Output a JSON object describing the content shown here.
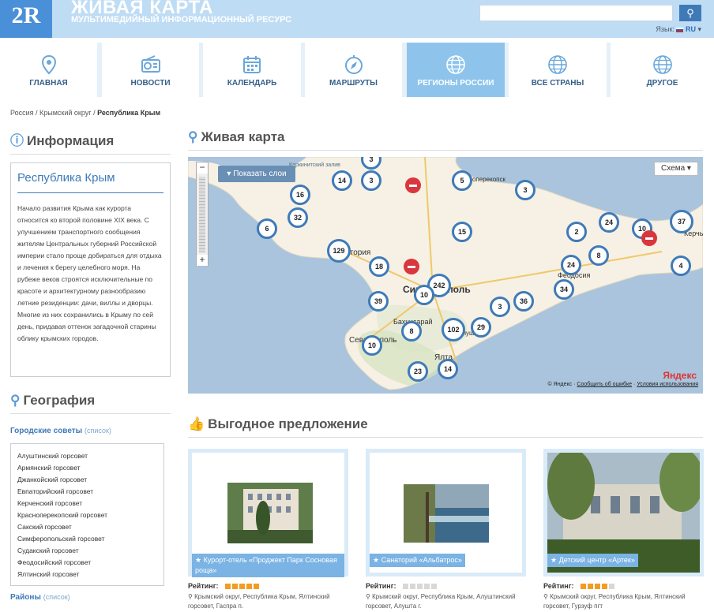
{
  "header": {
    "logo": "2R",
    "title": "ЖИВАЯ КАРТА",
    "subtitle": "МУЛЬТИМЕДИЙНЫЙ ИНФОРМАЦИОННЫЙ РЕСУРС",
    "search_placeholder": "",
    "search_icon": "search-icon",
    "lang_label": "Язык:",
    "lang_value": "RU"
  },
  "nav": [
    {
      "label": "ГЛАВНАЯ",
      "icon": "location-pin-icon",
      "active": false
    },
    {
      "label": "НОВОСТИ",
      "icon": "radio-icon",
      "active": false
    },
    {
      "label": "КАЛЕНДАРЬ",
      "icon": "calendar-icon",
      "active": false
    },
    {
      "label": "МАРШРУТЫ",
      "icon": "compass-icon",
      "active": false
    },
    {
      "label": "РЕГИОНЫ РОССИИ",
      "icon": "globe-icon",
      "active": true
    },
    {
      "label": "ВСЕ СТРАНЫ",
      "icon": "globe-icon",
      "active": false
    },
    {
      "label": "ДРУГОЕ",
      "icon": "globe-icon",
      "active": false
    }
  ],
  "breadcrumb": {
    "items": [
      "Россия",
      "Крымский округ"
    ],
    "current": "Республика Крым",
    "sep": " / "
  },
  "info": {
    "heading": "Информация",
    "title": "Республика Крым",
    "text": "Начало развития Крыма как курорта относится ко второй половине XIX века. С улучшением транспортного сообщения жителям Центральных губерний Российской империи стало проще добираться для отдыха и лечения к берегу целебного моря. На рубеже веков строятся исключительные по красоте и архитектурному разнообразию летние резиденции: дачи, виллы и дворцы. Многие из них сохранились в Крыму по сей день, придавая оттенок загадочной старины облику крымских городов."
  },
  "geography": {
    "heading": "География",
    "councils_label": "Городские советы",
    "councils_link": "(список)",
    "councils": [
      "Алуштинский горсовет",
      "Армянский горсовет",
      "Джанкойский горсовет",
      "Евпаторийский горсовет",
      "Керченский горсовет",
      "Красноперекопский горсовет",
      "Сакский горсовет",
      "Симферопольский горсовет",
      "Судакский горсовет",
      "Феодосийский горсовет",
      "Ялтинский горсовет"
    ],
    "districts_label": "Районы",
    "districts_link": "(список)"
  },
  "map": {
    "heading": "Живая карта",
    "layers_button": "▾ Показать слои",
    "scheme_button": "Схема ▾",
    "zoom_in": "+",
    "zoom_out": "−",
    "brand": "Яндекс",
    "copyright": "© Яндекс",
    "report_link": "Сообщить об ошибке",
    "terms_link": "Условия использования",
    "sep": " · ",
    "place_labels": [
      "Евпатория",
      "Симферополь",
      "Бахчисарай",
      "Севастополь",
      "Ялта",
      "Феодосия",
      "Алушта",
      "Керчь",
      "Красноперекопск",
      "Каркинитский залив"
    ],
    "markers": [
      "3",
      "14",
      "3",
      "5",
      "3",
      "16",
      "32",
      "6",
      "15",
      "2",
      "24",
      "10",
      "37",
      "129",
      "18",
      "24",
      "8",
      "4",
      "242",
      "10",
      "39",
      "3",
      "36",
      "34",
      "102",
      "29",
      "8",
      "10",
      "23",
      "14"
    ],
    "hotel_icon": "bed-icon"
  },
  "offers": {
    "heading": "Выгодное предложение",
    "rating_label": "Рейтинг:",
    "colors": {
      "filled": "#f39c22",
      "empty": "#d8d8d8"
    },
    "items": [
      {
        "caption": "Курорт-отель «Проджект Парк Сосновая роща»",
        "rating": 5,
        "address": "Крымский округ, Республика Крым, Ялтинский горсовет, Гаспра п."
      },
      {
        "caption": "Санаторий «Альбатрос»",
        "rating": 0,
        "address": "Крымский округ, Республика Крым, Алуштинский горсовет, Алушта г."
      },
      {
        "caption": "Детский центр «Артек»",
        "rating": 4,
        "address": "Крымский округ, Республика Крым, Ялтинский горсовет, Гурзуф пгт"
      }
    ]
  }
}
